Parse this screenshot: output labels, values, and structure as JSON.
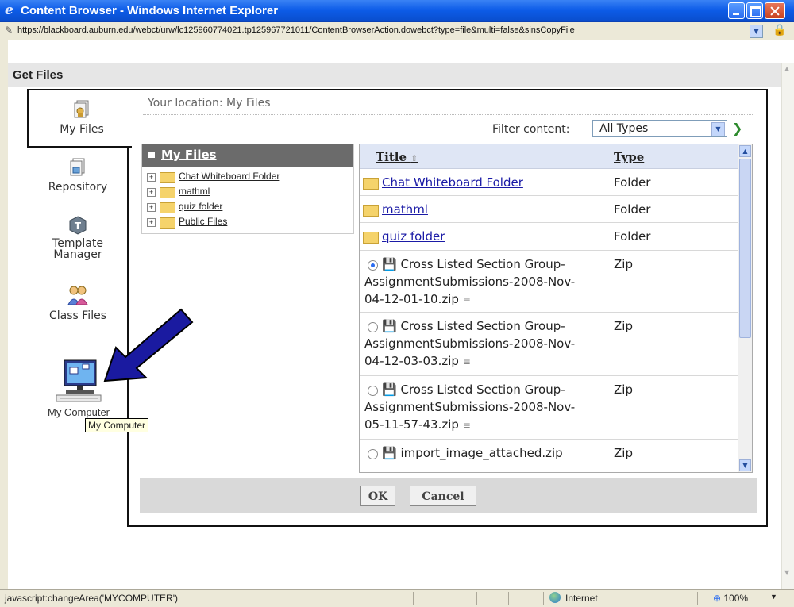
{
  "window": {
    "title": "Content Browser - Windows Internet Explorer",
    "url": "https://blackboard.auburn.edu/webct/urw/lc125960774021.tp125967721011/ContentBrowserAction.dowebct?type=file&multi=false&sinsCopyFile"
  },
  "page": {
    "heading": "Get Files",
    "location": "Your location: My Files",
    "filter_label": "Filter content:",
    "filter_value": "All Types"
  },
  "nav": [
    {
      "label": "My Files",
      "icon": "my-files-icon"
    },
    {
      "label": "Repository",
      "icon": "repository-icon"
    },
    {
      "label": "Template\nManager",
      "icon": "template-manager-icon"
    },
    {
      "label": "Class Files",
      "icon": "class-files-icon"
    },
    {
      "label": "My Computer",
      "icon": "my-computer-icon"
    }
  ],
  "tooltip": "My Computer",
  "tree": {
    "header": "My Files",
    "items": [
      "Chat Whiteboard Folder",
      "mathml",
      "quiz folder",
      "Public Files"
    ]
  },
  "table": {
    "headers": {
      "title": "Title",
      "type": "Type"
    },
    "folders": [
      {
        "name": "Chat Whiteboard Folder",
        "type": "Folder"
      },
      {
        "name": "mathml",
        "type": "Folder"
      },
      {
        "name": "quiz folder",
        "type": "Folder"
      }
    ],
    "files": [
      {
        "name": "Cross Listed Section Group-AssignmentSubmissions-2008-Nov-04-12-01-10.zip",
        "l1": "Cross Listed Section Group-",
        "l2": "AssignmentSubmissions-2008-Nov-",
        "l3": "04-12-01-10.zip",
        "type": "Zip",
        "selected": true
      },
      {
        "name": "Cross Listed Section Group-AssignmentSubmissions-2008-Nov-04-12-03-03.zip",
        "l1": "Cross Listed Section Group-",
        "l2": "AssignmentSubmissions-2008-Nov-",
        "l3": "04-12-03-03.zip",
        "type": "Zip",
        "selected": false
      },
      {
        "name": "Cross Listed Section Group-AssignmentSubmissions-2008-Nov-05-11-57-43.zip",
        "l1": "Cross Listed Section Group-",
        "l2": "AssignmentSubmissions-2008-Nov-",
        "l3": "05-11-57-43.zip",
        "type": "Zip",
        "selected": false
      },
      {
        "name": "import_image_attached.zip",
        "l1": "import_image_attached.zip",
        "type": "Zip",
        "selected": false
      }
    ]
  },
  "buttons": {
    "ok": "OK",
    "cancel": "Cancel"
  },
  "status": {
    "message": "javascript:changeArea('MYCOMPUTER')",
    "zone": "Internet",
    "zoom": "100%"
  },
  "colors": {
    "titlebar": "#0d5ce8",
    "arrow": "#1a1aa0",
    "link": "#1a1aa6"
  }
}
